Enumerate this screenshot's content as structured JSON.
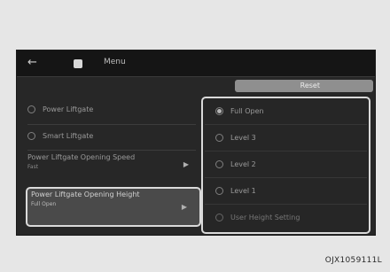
{
  "header": {
    "menu_label": "Menu",
    "reset_label": "Reset"
  },
  "left_menu": {
    "items": [
      {
        "label": "Power Liftgate"
      },
      {
        "label": "Smart Liftgate"
      },
      {
        "label": "Power Liftgate Opening Speed",
        "subtext": "Fast"
      },
      {
        "label": "Power Liftgate Opening Height",
        "subtext": "Full Open"
      }
    ]
  },
  "options": [
    {
      "label": "Full Open",
      "selected": true
    },
    {
      "label": "Level 3",
      "selected": false
    },
    {
      "label": "Level 2",
      "selected": false
    },
    {
      "label": "Level 1",
      "selected": false
    },
    {
      "label": "User Height Setting",
      "selected": false
    }
  ],
  "icons": {
    "back": "back-arrow-icon",
    "home": "home-icon",
    "chevron": "chevron-right-icon"
  },
  "caption": "OJX1059111L"
}
